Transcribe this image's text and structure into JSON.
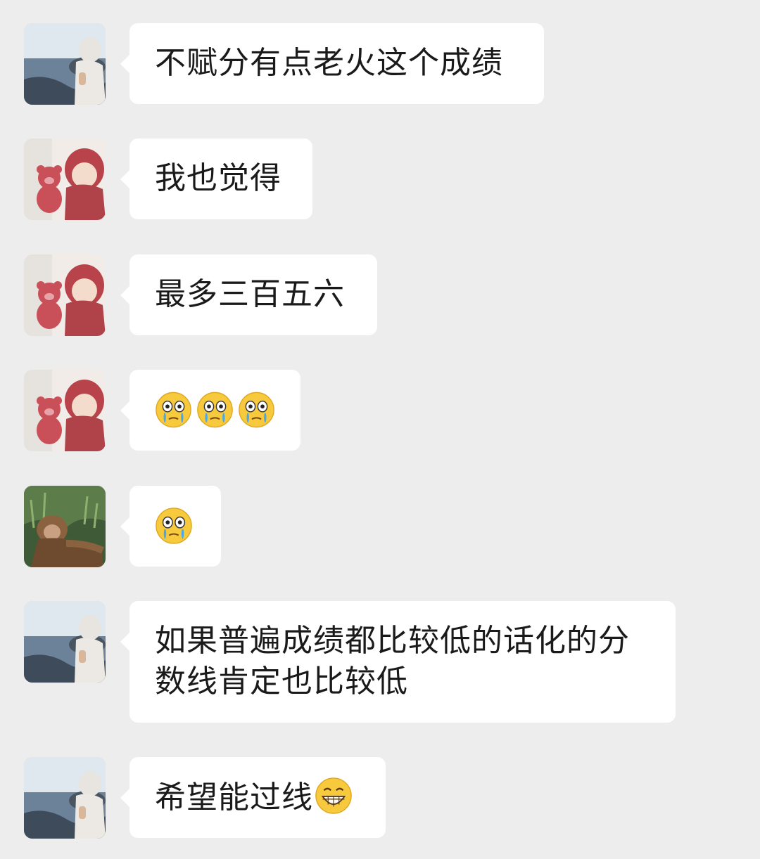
{
  "chat": {
    "messages": [
      {
        "sender": "girl-sea",
        "text": "不赋分有点老火这个成绩"
      },
      {
        "sender": "bear-child",
        "text": "我也觉得"
      },
      {
        "sender": "bear-child",
        "text": "最多三百五六"
      },
      {
        "sender": "bear-child",
        "emojis": [
          "cry-emoji",
          "cry-emoji",
          "cry-emoji"
        ]
      },
      {
        "sender": "monkey",
        "emojis": [
          "cry-emoji"
        ]
      },
      {
        "sender": "girl-sea",
        "text_line1": "如果普遍成绩都比较低的话化的分",
        "text_line2": "数线肯定也比较低"
      },
      {
        "sender": "girl-sea",
        "text": "希望能过线",
        "trailing_emoji": "grin-emoji"
      }
    ]
  },
  "colors": {
    "background": "#ededed",
    "bubble": "#ffffff",
    "text": "#1a1a1a"
  }
}
